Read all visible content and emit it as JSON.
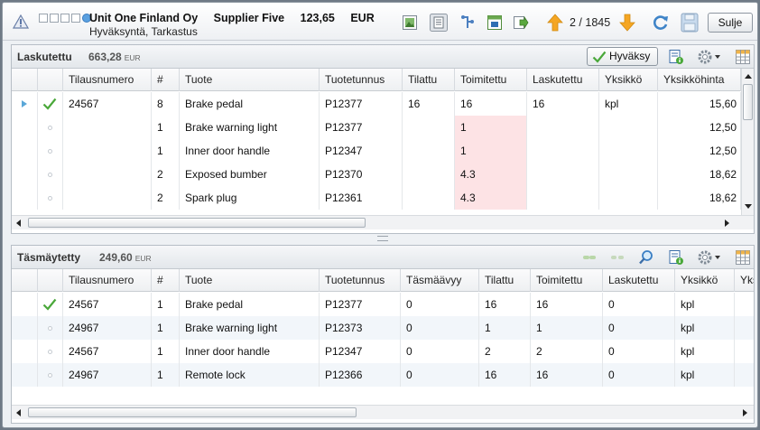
{
  "header": {
    "company": "Unit One Finland Oy",
    "supplier": "Supplier Five",
    "amount": "123,65",
    "currency": "EUR",
    "subtitle": "Hyväksyntä, Tarkastus",
    "pager": "2 / 1845",
    "close_label": "Sulje"
  },
  "top_panel": {
    "title": "Laskutettu",
    "amount": "663,28",
    "currency": "EUR",
    "approve_label": "Hyväksy",
    "columns": [
      "Tilausnumero",
      "#",
      "Tuote",
      "Tuotetunnus",
      "Tilattu",
      "Toimitettu",
      "Laskutettu",
      "Yksikkö",
      "Yksikköhinta"
    ],
    "rows": [
      {
        "order": "24567",
        "num": "8",
        "product": "Brake pedal",
        "code": "P12377",
        "ordered": "16",
        "delivered": "16",
        "invoiced": "16",
        "unit": "kpl",
        "price": "15,60",
        "selected": true,
        "checked": true
      },
      {
        "order": "",
        "num": "1",
        "product": "Brake warning light",
        "code": "P12377",
        "ordered": "",
        "delivered": "1",
        "invoiced": "",
        "unit": "",
        "price": "12,50",
        "selected": false,
        "checked": false
      },
      {
        "order": "",
        "num": "1",
        "product": "Inner door handle",
        "code": "P12347",
        "ordered": "",
        "delivered": "1",
        "invoiced": "",
        "unit": "",
        "price": "12,50",
        "selected": false,
        "checked": false
      },
      {
        "order": "",
        "num": "2",
        "product": "Exposed bumber",
        "code": "P12370",
        "ordered": "",
        "delivered": "4.3",
        "invoiced": "",
        "unit": "",
        "price": "18,62",
        "selected": false,
        "checked": false
      },
      {
        "order": "",
        "num": "2",
        "product": "Spark plug",
        "code": "P12361",
        "ordered": "",
        "delivered": "4.3",
        "invoiced": "",
        "unit": "",
        "price": "18,62",
        "selected": false,
        "checked": false
      }
    ]
  },
  "bottom_panel": {
    "title": "Täsmäytetty",
    "amount": "249,60",
    "currency": "EUR",
    "columns": [
      "Tilausnumero",
      "#",
      "Tuote",
      "Tuotetunnus",
      "Täsmäävyy",
      "Tilattu",
      "Toimitettu",
      "Laskutettu",
      "Yksikkö",
      "Yks"
    ],
    "rows": [
      {
        "order": "24567",
        "num": "1",
        "product": "Brake pedal",
        "code": "P12377",
        "match": "0",
        "ordered": "16",
        "delivered": "16",
        "invoiced": "0",
        "unit": "kpl",
        "checked": true
      },
      {
        "order": "24967",
        "num": "1",
        "product": "Brake warning light",
        "code": "P12373",
        "match": "0",
        "ordered": "1",
        "delivered": "1",
        "invoiced": "0",
        "unit": "kpl",
        "checked": false
      },
      {
        "order": "24567",
        "num": "1",
        "product": "Inner door handle",
        "code": "P12347",
        "match": "0",
        "ordered": "2",
        "delivered": "2",
        "invoiced": "0",
        "unit": "kpl",
        "checked": false
      },
      {
        "order": "24967",
        "num": "1",
        "product": "Remote lock",
        "code": "P12366",
        "match": "0",
        "ordered": "16",
        "delivered": "16",
        "invoiced": "0",
        "unit": "kpl",
        "checked": false
      }
    ]
  },
  "icons": {
    "warning": "warning-triangle-icon",
    "image": "image-icon",
    "document": "document-list-icon",
    "route": "route-icon",
    "export": "export-icon",
    "prev": "arrow-up-icon",
    "next": "arrow-down-icon",
    "refresh": "refresh-icon",
    "save": "save-icon",
    "accent_check": "#4aa83a",
    "accent_arrow": "#f5a623"
  }
}
